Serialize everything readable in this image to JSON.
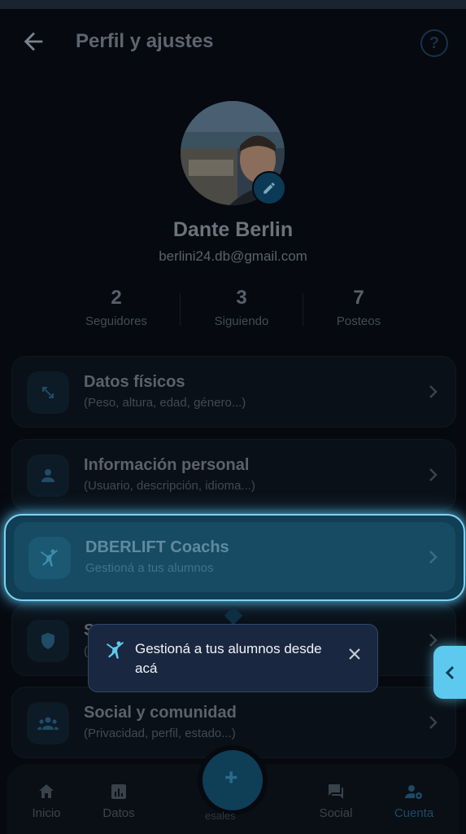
{
  "header": {
    "title": "Perfil y ajustes"
  },
  "profile": {
    "name": "Dante Berlin",
    "email": "berlini24.db@gmail.com"
  },
  "stats": [
    {
      "value": "2",
      "label": "Seguidores"
    },
    {
      "value": "3",
      "label": "Siguiendo"
    },
    {
      "value": "7",
      "label": "Posteos"
    }
  ],
  "menu": [
    {
      "title": "Datos físicos",
      "subtitle": "(Peso, altura, edad, género...)",
      "icon": "resize-arrows-icon"
    },
    {
      "title": "Información personal",
      "subtitle": "(Usuario, descripción, idioma...)",
      "icon": "person-icon"
    },
    {
      "title": "DBERLIFT Coachs",
      "subtitle": "Gestioná a tus alumnos",
      "icon": "coach-figure-icon"
    },
    {
      "title": "S",
      "subtitle": "(",
      "icon": "shield-icon"
    },
    {
      "title": "Social y comunidad",
      "subtitle": "(Privacidad, perfil, estado...)",
      "icon": "group-icon"
    }
  ],
  "tooltip": {
    "text": "Gestioná a tus alumnos desde acá"
  },
  "bottom_nav": {
    "items": [
      {
        "label": "Inicio",
        "icon": "home-icon"
      },
      {
        "label": "Datos",
        "icon": "chart-icon"
      },
      {
        "label": "Social",
        "icon": "chat-icon"
      },
      {
        "label": "Cuenta",
        "icon": "account-settings-icon"
      }
    ],
    "fab_label": "esales"
  },
  "colors": {
    "accent": "#5ec9ef",
    "highlight_border": "#7fd3f2",
    "background": "#06090f"
  }
}
